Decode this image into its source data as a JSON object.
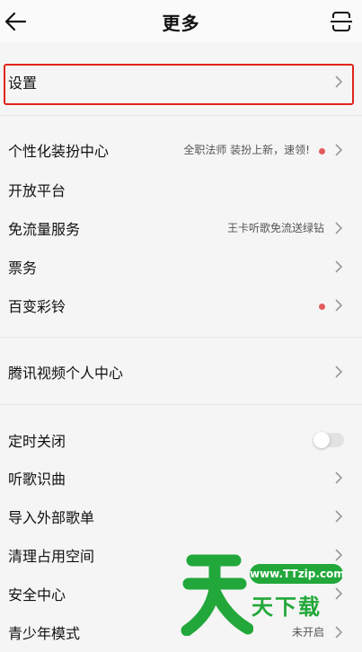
{
  "header": {
    "title": "更多",
    "back_icon": "arrow-left-icon",
    "scan_icon": "scan-icon"
  },
  "group1": {
    "settings": {
      "label": "设置"
    }
  },
  "group2": {
    "personalize": {
      "label": "个性化装扮中心",
      "sub": "全职法师 装扮上新，速领!",
      "has_dot": true
    },
    "open_platform": {
      "label": "开放平台"
    },
    "free_traffic": {
      "label": "免流量服务",
      "sub": "王卡听歌免流送绿钻"
    },
    "tickets": {
      "label": "票务"
    },
    "ringtone": {
      "label": "百变彩铃",
      "has_dot": true
    }
  },
  "group3": {
    "tencent_video": {
      "label": "腾讯视频个人中心"
    }
  },
  "group4": {
    "timer_off": {
      "label": "定时关闭",
      "toggle_on": false
    },
    "song_recognition": {
      "label": "听歌识曲"
    },
    "import_playlist": {
      "label": "导入外部歌单"
    },
    "clear_space": {
      "label": "清理占用空间"
    },
    "security_center": {
      "label": "安全中心"
    },
    "teen_mode": {
      "label": "青少年模式",
      "sub": "未开启"
    }
  },
  "watermark": {
    "url": "www.TTzip.com",
    "text": "天下载",
    "big_char": "天"
  },
  "colors": {
    "highlight_border": "#e0251b",
    "dot": "#e35b5b",
    "watermark_green": "#22a83a",
    "background": "#f5f5f5"
  }
}
